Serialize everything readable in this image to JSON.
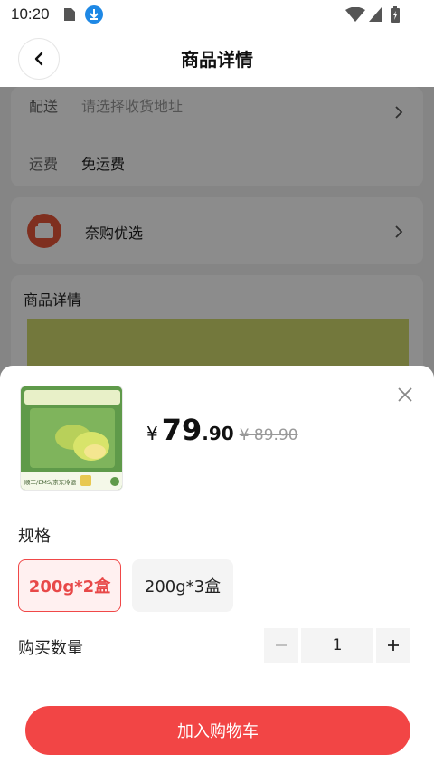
{
  "status_bar": {
    "time": "10:20"
  },
  "header": {
    "title": "商品详情"
  },
  "background": {
    "delivery_label": "配送",
    "delivery_value": "请选择收货地址",
    "shipping_label": "运费",
    "shipping_value": "免运费",
    "store_name": "奈购优选",
    "details_heading": "商品详情"
  },
  "sheet": {
    "price_symbol": "¥",
    "price_integer": "79",
    "price_decimal": ".90",
    "original_price": "¥ 89.90",
    "spec_title": "规格",
    "specs": [
      {
        "label": "200g*2盒",
        "selected": true
      },
      {
        "label": "200g*3盒",
        "selected": false
      }
    ],
    "quantity_label": "购买数量",
    "quantity_value": "1",
    "add_to_cart": "加入购物车",
    "thumb_text": "顺丰/EMS/京东冷运"
  },
  "colors": {
    "accent": "#f24545",
    "selected_text": "#e84848",
    "thumb_bg": "#5f9a4a"
  }
}
